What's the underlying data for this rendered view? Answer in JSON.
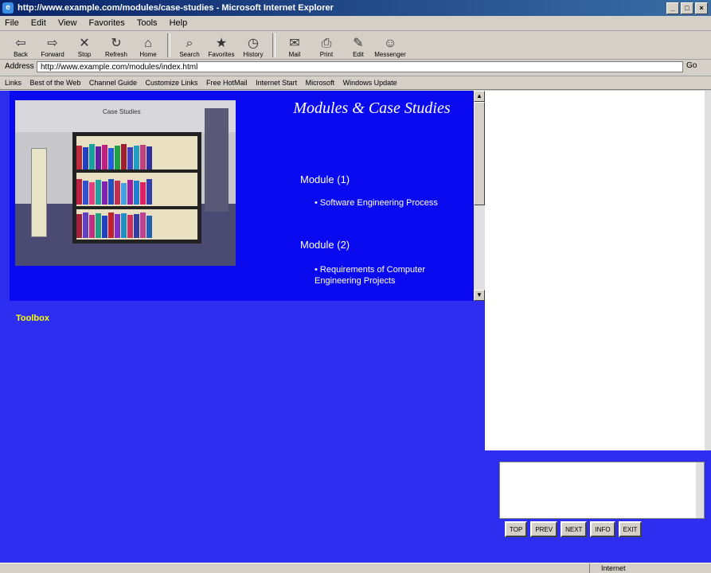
{
  "window": {
    "title": "http://www.example.com/modules/case-studies - Microsoft Internet Explorer"
  },
  "menu": [
    "File",
    "Edit",
    "View",
    "Favorites",
    "Tools",
    "Help"
  ],
  "toolbar": [
    {
      "icon": "back-icon",
      "label": "Back"
    },
    {
      "icon": "forward-icon",
      "label": "Forward"
    },
    {
      "icon": "stop-icon",
      "label": "Stop"
    },
    {
      "icon": "refresh-icon",
      "label": "Refresh"
    },
    {
      "icon": "home-icon",
      "label": "Home"
    },
    {
      "icon": "search-icon",
      "label": "Search"
    },
    {
      "icon": "favorites-icon",
      "label": "Favorites"
    },
    {
      "icon": "history-icon",
      "label": "History"
    },
    {
      "icon": "mail-icon",
      "label": "Mail"
    },
    {
      "icon": "print-icon",
      "label": "Print"
    },
    {
      "icon": "edit-icon",
      "label": "Edit"
    },
    {
      "icon": "messenger-icon",
      "label": "Messenger"
    }
  ],
  "address": {
    "label": "Address",
    "url": "http://www.example.com/modules/index.html",
    "go": "Go"
  },
  "links": [
    "Links",
    "Best of the Web",
    "Channel Guide",
    "Customize Links",
    "Free HotMail",
    "Internet Start",
    "Microsoft",
    "Windows Update"
  ],
  "page": {
    "image_caption": "Case Studies",
    "heading": "Modules & Case Studies",
    "module1": {
      "label": "Module (1)",
      "item": "Software Engineering Process"
    },
    "module2": {
      "label": "Module (2)",
      "item": "Requirements of Computer Engineering Projects"
    },
    "toolbox": "Toolbox"
  },
  "buttons": [
    "TOP",
    "PREV",
    "NEXT",
    "INFO",
    "EXIT"
  ],
  "status": {
    "left": "",
    "right": "Internet"
  }
}
